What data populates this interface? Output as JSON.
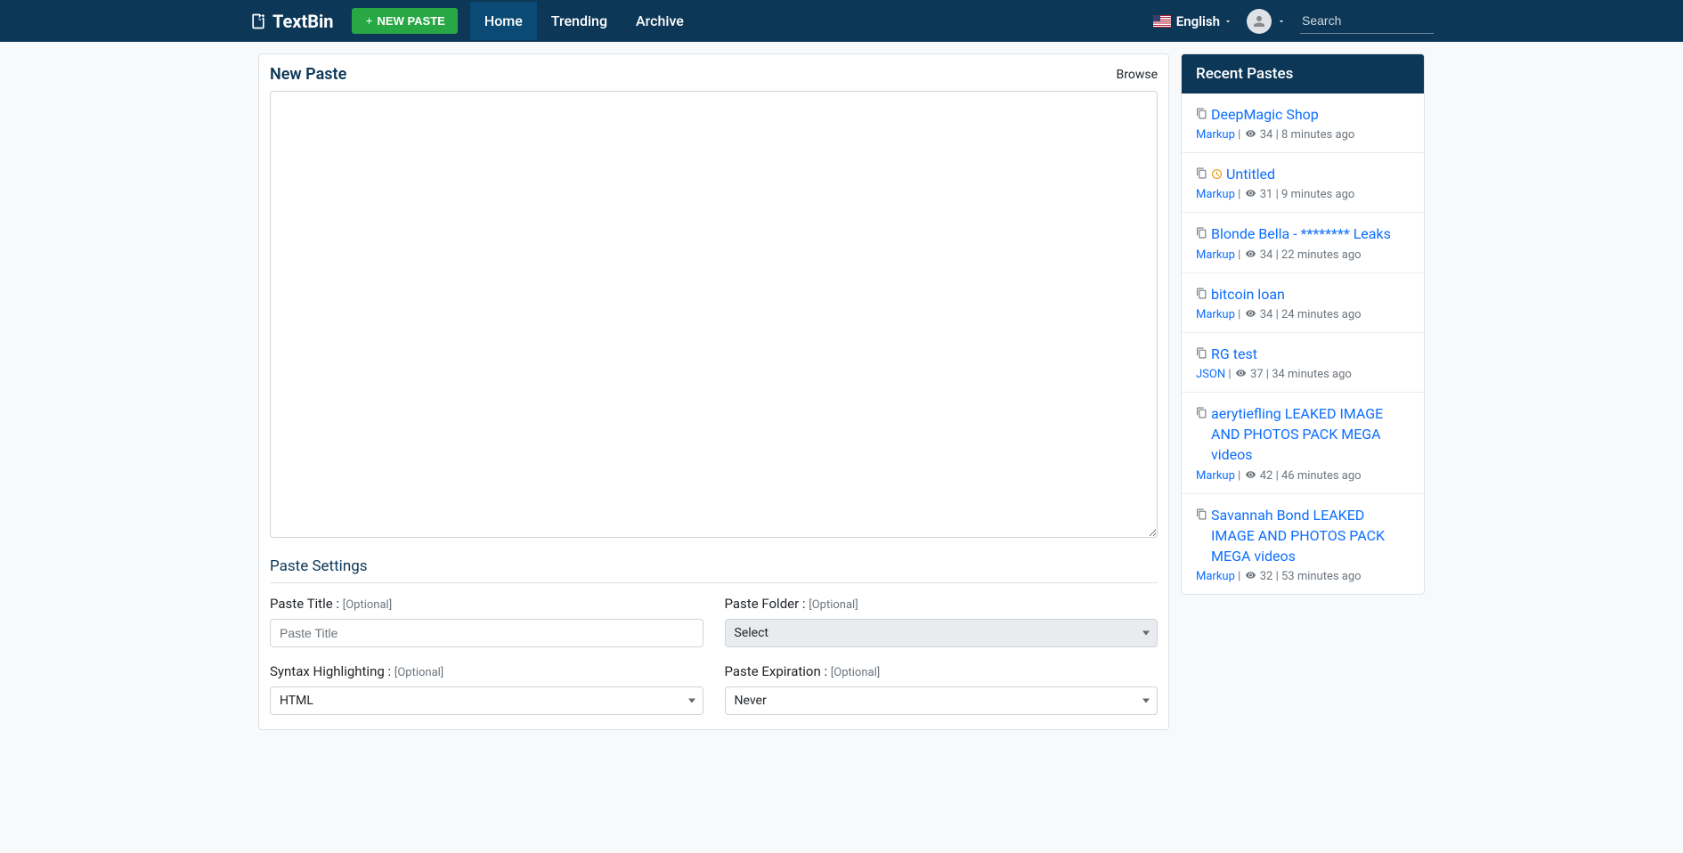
{
  "brand": "TextBin",
  "nav": {
    "new_paste_label": "NEW PASTE",
    "links": [
      "Home",
      "Trending",
      "Archive"
    ],
    "language": "English",
    "search_placeholder": "Search"
  },
  "main": {
    "title": "New Paste",
    "browse_label": "Browse",
    "settings_title": "Paste Settings",
    "fields": {
      "title_label": "Paste Title : ",
      "title_optional": "[Optional]",
      "title_placeholder": "Paste Title",
      "folder_label": "Paste Folder : ",
      "folder_optional": "[Optional]",
      "folder_value": "Select",
      "syntax_label": "Syntax Highlighting : ",
      "syntax_optional": "[Optional]",
      "syntax_value": "HTML",
      "expiration_label": "Paste Expiration : ",
      "expiration_optional": "[Optional]",
      "expiration_value": "Never"
    }
  },
  "sidebar": {
    "title": "Recent Pastes",
    "items": [
      {
        "title": "DeepMagic Shop",
        "has_clock": false,
        "lang": "Markup",
        "views": "34",
        "time": "8 minutes ago"
      },
      {
        "title": "Untitled",
        "has_clock": true,
        "lang": "Markup",
        "views": "31",
        "time": "9 minutes ago"
      },
      {
        "title": "Blonde Bella - ******** Leaks",
        "has_clock": false,
        "lang": "Markup",
        "views": "34",
        "time": "22 minutes ago"
      },
      {
        "title": "bitcoin loan",
        "has_clock": false,
        "lang": "Markup",
        "views": "34",
        "time": "24 minutes ago"
      },
      {
        "title": "RG test",
        "has_clock": false,
        "lang": "JSON",
        "views": "37",
        "time": "34 minutes ago"
      },
      {
        "title": "aerytiefling LEAKED IMAGE AND PHOTOS PACK MEGA videos",
        "has_clock": false,
        "lang": "Markup",
        "views": "42",
        "time": "46 minutes ago"
      },
      {
        "title": "Savannah Bond LEAKED IMAGE AND PHOTOS PACK MEGA videos",
        "has_clock": false,
        "lang": "Markup",
        "views": "32",
        "time": "53 minutes ago"
      }
    ]
  }
}
